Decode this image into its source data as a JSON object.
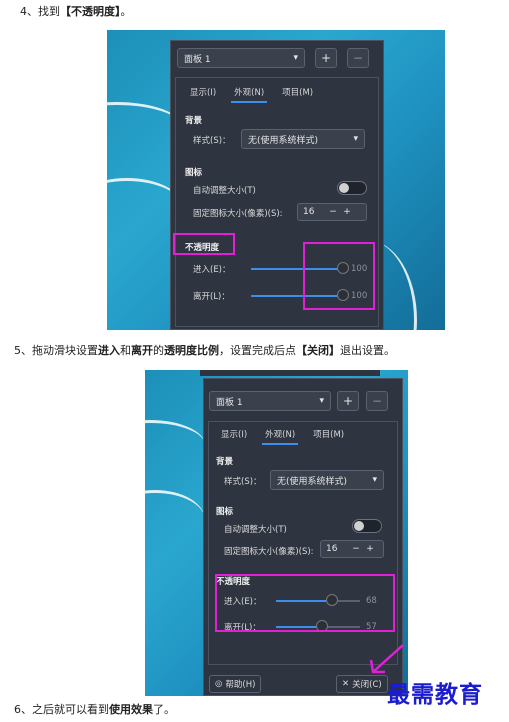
{
  "steps": {
    "step4_prefix": "4、找到",
    "step4_bold": "【不透明度】",
    "step4_suffix": "。",
    "step5_a": "5、拖动滑块设置",
    "step5_b": "进入",
    "step5_c": "和",
    "step5_d": "离开",
    "step5_e": "的",
    "step5_f": "透明度比例",
    "step5_g": "，设置完成后点",
    "step5_h": "【关闭】",
    "step5_i": "退出设置。",
    "step6_a": "6、之后就可以看到",
    "step6_b": "使用效果",
    "step6_c": "了。"
  },
  "screenshot1": {
    "panel_select": "面板 1",
    "add_btn": "+",
    "remove_btn": "−",
    "tabs": [
      "显示(I)",
      "外观(N)",
      "项目(M)"
    ],
    "active_tab": "外观(N)",
    "bg_heading": "背景",
    "style_label": "样式(S)：",
    "style_value": "无(使用系统样式)",
    "icon_heading": "图标",
    "auto_size_label": "自动调整大小(T)",
    "fixed_size_label": "固定图标大小(像素)(S):",
    "fixed_size_value": "16",
    "opacity_heading": "不透明度",
    "enter_label": "进入(E)：",
    "leave_label": "离开(L)：",
    "enter_value": "100",
    "leave_value": "100"
  },
  "screenshot2": {
    "panel_select": "面板 1",
    "add_btn": "+",
    "remove_btn": "−",
    "tabs": [
      "显示(I)",
      "外观(N)",
      "项目(M)"
    ],
    "active_tab": "外观(N)",
    "bg_heading": "背景",
    "style_label": "样式(S)：",
    "style_value": "无(使用系统样式)",
    "icon_heading": "图标",
    "auto_size_label": "自动调整大小(T)",
    "fixed_size_label": "固定图标大小(像素)(S):",
    "fixed_size_value": "16",
    "opacity_heading": "不透明度",
    "enter_label": "进入(E)：",
    "leave_label": "离开(L)：",
    "enter_value": "68",
    "leave_value": "57",
    "help_btn": "帮助(H)",
    "close_btn": "关闭(C)"
  },
  "watermark": "最需教育",
  "colors": {
    "highlight": "#e21fd6",
    "accent": "#3d8ee8",
    "panel": "#2e3440"
  }
}
